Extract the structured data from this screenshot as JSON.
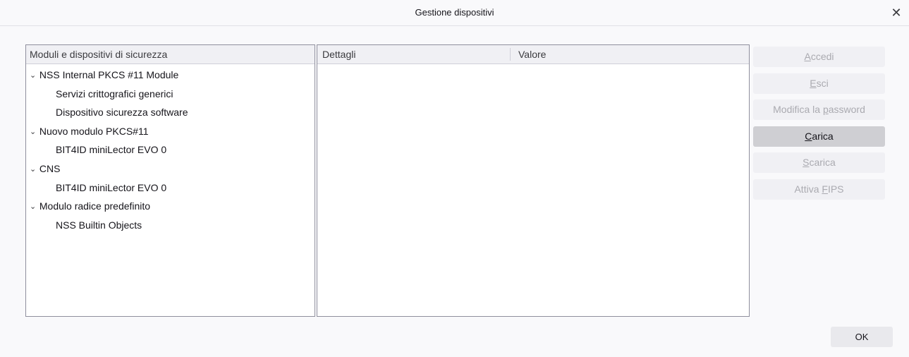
{
  "window": {
    "title": "Gestione dispositivi",
    "close_glyph": "✕"
  },
  "tree": {
    "header": "Moduli e dispositivi di sicurezza",
    "rows": [
      {
        "label": "NSS Internal PKCS #11 Module",
        "kind": "module",
        "expanded": true
      },
      {
        "label": "Servizi crittografici generici",
        "kind": "slot"
      },
      {
        "label": "Dispositivo sicurezza software",
        "kind": "slot"
      },
      {
        "label": "Nuovo modulo PKCS#11",
        "kind": "module",
        "expanded": true
      },
      {
        "label": "BIT4ID miniLector EVO 0",
        "kind": "slot"
      },
      {
        "label": "CNS",
        "kind": "module",
        "expanded": true
      },
      {
        "label": "BIT4ID miniLector EVO 0",
        "kind": "slot"
      },
      {
        "label": "Modulo radice predefinito",
        "kind": "module",
        "expanded": true
      },
      {
        "label": "NSS Builtin Objects",
        "kind": "slot"
      }
    ],
    "twisty_glyph": "⌄"
  },
  "details": {
    "columns": [
      "Dettagli",
      "Valore"
    ],
    "rows": []
  },
  "actions": {
    "buttons": [
      {
        "pre": "",
        "key": "A",
        "post": "ccedi",
        "enabled": false,
        "name": "login-button"
      },
      {
        "pre": "",
        "key": "E",
        "post": "sci",
        "enabled": false,
        "name": "logout-button"
      },
      {
        "pre": "Modifica la ",
        "key": "p",
        "post": "assword",
        "enabled": false,
        "name": "change-password-button"
      },
      {
        "pre": "",
        "key": "C",
        "post": "arica",
        "enabled": true,
        "name": "load-button"
      },
      {
        "pre": "",
        "key": "S",
        "post": "carica",
        "enabled": false,
        "name": "unload-button"
      },
      {
        "pre": "Attiva ",
        "key": "F",
        "post": "IPS",
        "enabled": false,
        "name": "enable-fips-button"
      }
    ]
  },
  "footer": {
    "ok_label": "OK"
  }
}
